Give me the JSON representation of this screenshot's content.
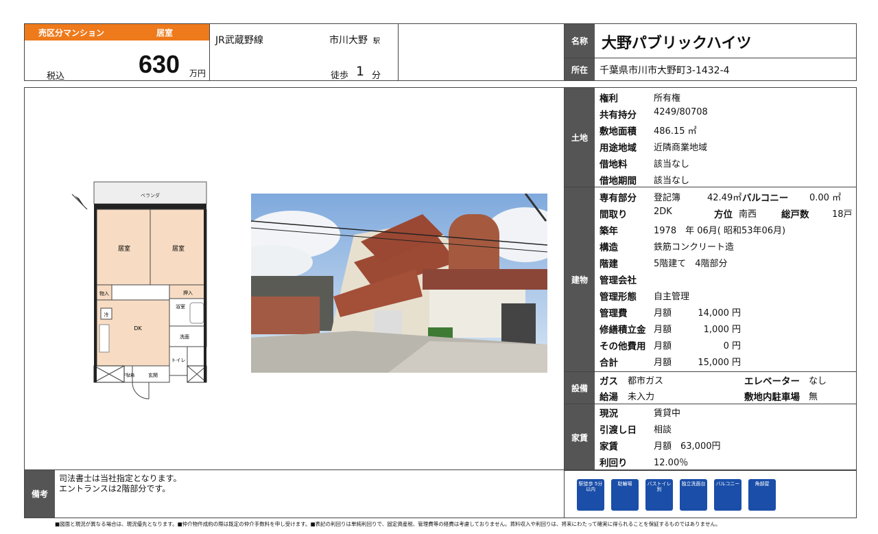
{
  "header": {
    "type_label": "売区分マンション",
    "room_label": "居室",
    "tax_label": "税込",
    "price": "630",
    "price_unit": "万円",
    "line": "JR武蔵野線",
    "station": "市川大野",
    "station_suffix": "駅",
    "walk_label": "徒歩",
    "walk_min": "1",
    "walk_unit": "分",
    "name_label": "名称",
    "name": "大野パブリックハイツ",
    "address_label": "所在",
    "address": "千葉県市川市大野町3-1432-4"
  },
  "land": {
    "section": "土地",
    "rows": [
      {
        "label": "権利",
        "value": "所有権"
      },
      {
        "label": "共有持分",
        "value": "4249/80708"
      },
      {
        "label": "敷地面積",
        "value": "486.15 ㎡"
      },
      {
        "label": "用途地域",
        "value": "近隣商業地域"
      },
      {
        "label": "借地料",
        "value": "該当なし"
      },
      {
        "label": "借地期間",
        "value": "該当なし"
      }
    ]
  },
  "building": {
    "section": "建物",
    "area_label": "専有部分",
    "area_basis": "登記簿",
    "area_value": "42.49㎡",
    "balcony_label": "バルコニー",
    "balcony_value": "0.00 ㎡",
    "layout_label": "間取り",
    "layout_value": "2DK",
    "direction_label": "方位",
    "direction_value": "南西",
    "units_label": "総戸数",
    "units_value": "18戸",
    "built_label": "築年",
    "built_value": "1978　年 06月( 昭和53年06月)",
    "structure_label": "構造",
    "structure_value": "鉄筋コンクリート造",
    "floors_label": "階建",
    "floors_value": "5階建て　4階部分",
    "mgmt_co_label": "管理会社",
    "mgmt_form_label": "管理形態",
    "mgmt_form_value": "自主管理",
    "fees": [
      {
        "label": "管理費",
        "period": "月額",
        "amount": "14,000 円"
      },
      {
        "label": "修繕積立金",
        "period": "月額",
        "amount": "1,000 円"
      },
      {
        "label": "その他費用",
        "period": "月額",
        "amount": "0 円"
      },
      {
        "label": "合計",
        "period": "月額",
        "amount": "15,000 円"
      }
    ]
  },
  "equipment": {
    "section": "設備",
    "gas_label": "ガス",
    "gas_value": "都市ガス",
    "elevator_label": "エレベーター",
    "elevator_value": "なし",
    "hotwater_label": "給湯",
    "hotwater_value": "未入力",
    "parking_label": "敷地内駐車場",
    "parking_value": "無"
  },
  "rent": {
    "section": "家賃",
    "rows": [
      {
        "label": "現況",
        "value": "賃貸中"
      },
      {
        "label": "引渡し日",
        "value": "相談"
      },
      {
        "label": "家賃",
        "value": "月額　63,000円"
      },
      {
        "label": "利回り",
        "value": "12.00％"
      }
    ]
  },
  "remarks": {
    "label": "備考",
    "line1": "司法書士は当社指定となります。",
    "line2": "エントランスは2階部分です。"
  },
  "icons": [
    {
      "name": "station-walk-icon",
      "text": "駅徒歩 5分以内"
    },
    {
      "name": "bicycle-parking-icon",
      "text": "駐輪場"
    },
    {
      "name": "bath-toilet-separate-icon",
      "text": "バストイレ別"
    },
    {
      "name": "vanity-icon",
      "text": "独立洗面台"
    },
    {
      "name": "balcony-icon",
      "text": "バルコニー"
    },
    {
      "name": "corner-room-icon",
      "text": "角部屋"
    }
  ],
  "floorplan": {
    "veranda": "ベランダ",
    "room1": "居室",
    "room2": "居室",
    "storage1": "物入",
    "storage2": "押入",
    "fridge": "冷",
    "dk": "DK",
    "bath": "浴室",
    "wash": "洗面",
    "toilet": "トイレ",
    "entrance": "玄関",
    "shoe": "下駄箱"
  },
  "footer": "■図面と現況が異なる場合は、現況優先となります。■仲介物件成約の際は既定の仲介手数料を申し受けます。■表記の利回りは単純利回りで、固定資産税、管理費等の経費は考慮しておりません。賃料収入や利回りは、将来にわたって確実に得られることを保証するものではありません。"
}
